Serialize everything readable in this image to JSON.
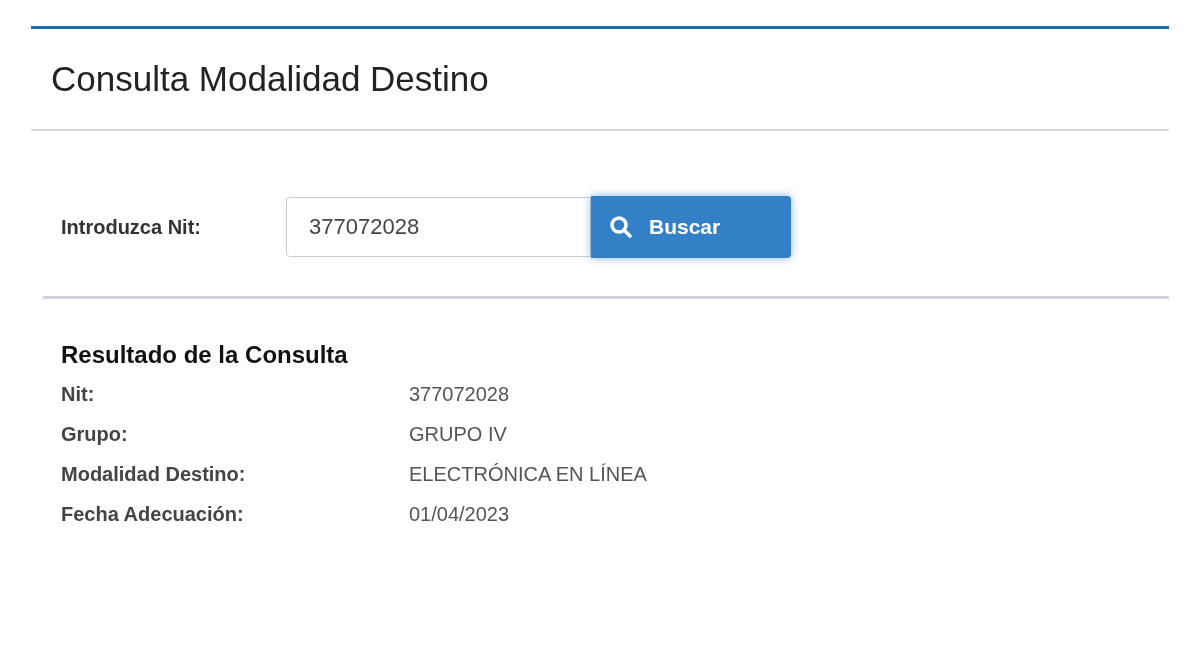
{
  "title": "Consulta Modalidad Destino",
  "search": {
    "label": "Introduzca Nit:",
    "value": "377072028",
    "button": "Buscar"
  },
  "result": {
    "heading": "Resultado de la Consulta",
    "rows": [
      {
        "label": "Nit:",
        "value": "377072028"
      },
      {
        "label": "Grupo:",
        "value": "GRUPO IV"
      },
      {
        "label": "Modalidad Destino:",
        "value": "ELECTRÓNICA EN LÍNEA"
      },
      {
        "label": "Fecha Adecuación:",
        "value": "01/04/2023"
      }
    ]
  }
}
